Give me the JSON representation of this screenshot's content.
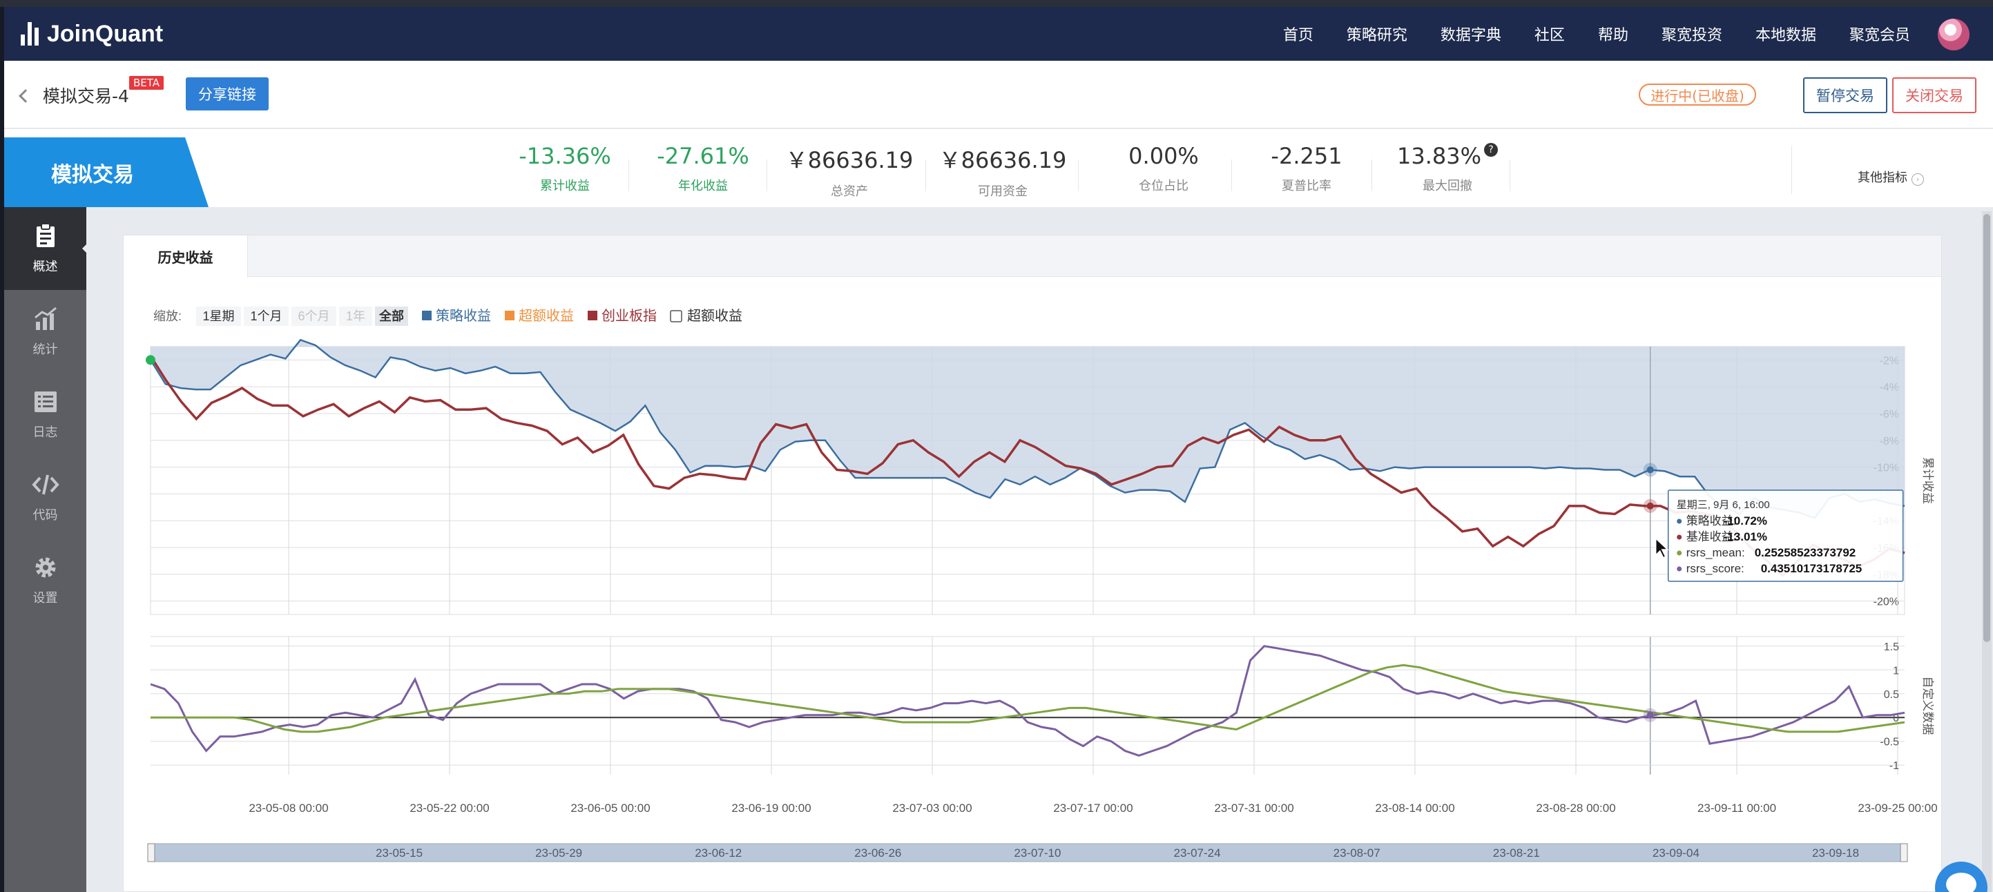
{
  "app": {
    "logo": "JoinQuant"
  },
  "nav": {
    "items": [
      "首页",
      "策略研究",
      "数据字典",
      "社区",
      "帮助",
      "聚宽投资",
      "本地数据",
      "聚宽会员"
    ]
  },
  "header": {
    "title": "模拟交易-4",
    "beta": "BETA",
    "share": "分享链接",
    "status": "进行中(已收盘)",
    "pause": "暂停交易",
    "close": "关闭交易"
  },
  "stats": {
    "mode": "模拟交易",
    "items": [
      {
        "value": "-13.36%",
        "label": "累计收益"
      },
      {
        "value": "-27.61%",
        "label": "年化收益"
      },
      {
        "value": "￥86636.19",
        "label": "总资产"
      },
      {
        "value": "￥86636.19",
        "label": "可用资金"
      },
      {
        "value": "0.00%",
        "label": "仓位占比"
      },
      {
        "value": "-2.251",
        "label": "夏普比率"
      },
      {
        "value": "13.83%",
        "label": "最大回撤"
      }
    ],
    "help": "?",
    "other": "其他指标",
    "colors": {
      "positive_label": "#2da35e"
    }
  },
  "sidebar": {
    "items": [
      {
        "label": "概述",
        "icon": "clipboard-icon"
      },
      {
        "label": "统计",
        "icon": "bar-chart-icon"
      },
      {
        "label": "日志",
        "icon": "list-icon"
      },
      {
        "label": "代码",
        "icon": "code-icon"
      },
      {
        "label": "设置",
        "icon": "gear-icon"
      }
    ]
  },
  "panel": {
    "tab": "历史收益"
  },
  "chart_data": {
    "type": "line",
    "controls": {
      "zoom_label": "缩放:",
      "ranges": [
        "1星期",
        "1个月",
        "6个月",
        "1年",
        "全部"
      ],
      "active_range": "全部",
      "disabled_ranges": [
        "6个月",
        "1年"
      ],
      "checkbox_label": "超额收益"
    },
    "legend": [
      {
        "name": "策略收益",
        "color": "#3c6e9f"
      },
      {
        "name": "超额收益",
        "color": "#f0903c"
      },
      {
        "name": "创业板指",
        "color": "#9b3336"
      }
    ],
    "main": {
      "ylabel": "累计收益",
      "ylim": [
        -21,
        -1
      ],
      "yticks": [
        "-2%",
        "-4%",
        "-6%",
        "-8%",
        "-10%",
        "-12%",
        "-14%",
        "-16%",
        "-18%",
        "-20%"
      ],
      "ytick_values": [
        -2,
        -4,
        -6,
        -8,
        -10,
        -12,
        -14,
        -16,
        -18,
        -20
      ],
      "series": [
        {
          "name": "策略收益",
          "color": "#3c6e9f",
          "values": [
            -2.0,
            -3.8,
            -4.1,
            -4.2,
            -4.2,
            -3.3,
            -2.4,
            -2.0,
            -1.6,
            -1.9,
            -0.5,
            -0.9,
            -1.8,
            -2.4,
            -2.8,
            -3.3,
            -1.8,
            -2.0,
            -2.5,
            -2.8,
            -2.6,
            -3.0,
            -2.8,
            -2.5,
            -3.0,
            -3.0,
            -2.9,
            -4.4,
            -5.7,
            -6.2,
            -6.7,
            -7.3,
            -6.6,
            -5.4,
            -7.4,
            -8.7,
            -10.4,
            -9.9,
            -9.9,
            -10.0,
            -9.9,
            -10.3,
            -8.7,
            -8.1,
            -8.0,
            -8.0,
            -9.5,
            -10.8,
            -10.8,
            -10.8,
            -10.8,
            -10.8,
            -10.8,
            -10.8,
            -11.3,
            -11.9,
            -12.3,
            -10.9,
            -11.3,
            -10.7,
            -11.3,
            -10.8,
            -10.1,
            -10.6,
            -11.4,
            -11.9,
            -11.7,
            -11.7,
            -11.8,
            -12.6,
            -10.1,
            -10.0,
            -7.2,
            -6.7,
            -7.6,
            -8.3,
            -8.7,
            -9.4,
            -9.1,
            -9.5,
            -10.2,
            -10.1,
            -10.3,
            -10.0,
            -10.1,
            -10.0,
            -10.0,
            -10.0,
            -10.0,
            -10.0,
            -10.0,
            -10.0,
            -10.0,
            -10.1,
            -10.0,
            -10.1,
            -10.1,
            -10.2,
            -10.2,
            -10.7,
            -10.2,
            -10.3,
            -10.7,
            -10.7,
            -12.2,
            -13.0,
            -13.5,
            -12.3,
            -13.0,
            -13.2,
            -13.4,
            -13.8,
            -12.3,
            -12.0,
            -12.6,
            -12.4,
            -12.7,
            -12.9
          ]
        },
        {
          "name": "创业板指",
          "color": "#9b3336",
          "values": [
            -1.7,
            -3.5,
            -5.1,
            -6.4,
            -5.2,
            -4.7,
            -4.1,
            -4.9,
            -5.4,
            -5.4,
            -6.2,
            -5.7,
            -5.3,
            -6.2,
            -5.6,
            -5.1,
            -5.9,
            -4.8,
            -5.1,
            -5.0,
            -5.7,
            -5.7,
            -5.6,
            -6.4,
            -6.7,
            -6.9,
            -7.3,
            -8.3,
            -7.8,
            -8.9,
            -8.4,
            -7.6,
            -9.8,
            -11.4,
            -11.6,
            -10.8,
            -10.5,
            -10.6,
            -10.8,
            -10.9,
            -8.2,
            -6.8,
            -7.1,
            -6.8,
            -8.9,
            -10.2,
            -10.3,
            -10.5,
            -9.7,
            -8.3,
            -8.0,
            -8.9,
            -9.6,
            -10.7,
            -9.6,
            -8.9,
            -9.6,
            -8.0,
            -8.5,
            -9.2,
            -9.9,
            -10.1,
            -10.5,
            -11.3,
            -10.9,
            -10.5,
            -10.0,
            -9.9,
            -8.4,
            -7.8,
            -8.2,
            -7.6,
            -7.2,
            -8.1,
            -7.0,
            -7.6,
            -8.0,
            -8.0,
            -7.7,
            -9.4,
            -10.5,
            -11.2,
            -11.9,
            -11.6,
            -12.9,
            -13.8,
            -14.8,
            -14.6,
            -15.9,
            -15.2,
            -15.9,
            -15.0,
            -14.4,
            -12.9,
            -12.9,
            -13.4,
            -13.5,
            -12.8,
            -12.9,
            -12.9,
            -13.4,
            -13.3,
            -13.5,
            -13.9,
            -14.9,
            -16.1,
            -17.0,
            -18.1,
            -17.0,
            -15.8,
            -16.4,
            -16.9,
            -17.4,
            -16.9,
            -16.1,
            -16.4
          ]
        }
      ],
      "tooltip": {
        "title": "星期三, 9月 6, 16:00",
        "rows": [
          {
            "label": "策略收益: ",
            "value": "-10.72%",
            "color": "#3c6e9f"
          },
          {
            "label": "基准收益: ",
            "value": "-13.01%",
            "color": "#9b3336"
          },
          {
            "label": "rsrs_mean: ",
            "value": "0.25258523373792",
            "color": "#7fa340"
          },
          {
            "label": "rsrs_score: ",
            "value": "0.43510173178725",
            "color": "#7b5fa0"
          }
        ]
      }
    },
    "sub": {
      "ylabel": "自定义数据",
      "ylim": [
        -1.2,
        1.7
      ],
      "yticks": [
        "1.5",
        "1",
        "0.5",
        "0",
        "-0.5",
        "-1"
      ],
      "ytick_values": [
        1.5,
        1,
        0.5,
        0,
        -0.5,
        -1
      ],
      "series": [
        {
          "name": "rsrs_score",
          "color": "#7b5fa0",
          "values": [
            0.7,
            0.6,
            0.3,
            -0.3,
            -0.7,
            -0.4,
            -0.4,
            -0.35,
            -0.3,
            -0.2,
            -0.15,
            -0.2,
            -0.15,
            0.05,
            0.1,
            0.05,
            0.0,
            0.15,
            0.3,
            0.8,
            0.05,
            -0.05,
            0.3,
            0.5,
            0.6,
            0.7,
            0.7,
            0.7,
            0.7,
            0.5,
            0.6,
            0.7,
            0.7,
            0.6,
            0.4,
            0.55,
            0.6,
            0.6,
            0.6,
            0.55,
            0.4,
            -0.05,
            -0.1,
            -0.2,
            -0.1,
            -0.05,
            0.0,
            0.05,
            0.05,
            0.05,
            0.1,
            0.1,
            0.05,
            0.1,
            0.2,
            0.15,
            0.2,
            0.3,
            0.3,
            0.35,
            0.3,
            0.35,
            0.2,
            -0.1,
            -0.2,
            -0.25,
            -0.45,
            -0.6,
            -0.4,
            -0.5,
            -0.7,
            -0.8,
            -0.7,
            -0.6,
            -0.45,
            -0.3,
            -0.2,
            -0.1,
            0.1,
            1.2,
            1.5,
            1.45,
            1.4,
            1.35,
            1.3,
            1.2,
            1.1,
            1.0,
            0.95,
            0.85,
            0.6,
            0.5,
            0.55,
            0.5,
            0.4,
            0.5,
            0.4,
            0.3,
            0.35,
            0.3,
            0.35,
            0.35,
            0.3,
            0.2,
            0.0,
            -0.05,
            -0.1,
            0.0,
            0.05,
            0.1,
            0.2,
            0.35,
            -0.55,
            -0.5,
            -0.45,
            -0.4,
            -0.3,
            -0.2,
            -0.1,
            0.05,
            0.2,
            0.35,
            0.65,
            0.0,
            0.05,
            0.05,
            0.1
          ]
        },
        {
          "name": "rsrs_mean",
          "color": "#7fa340",
          "values": [
            0.0,
            0.0,
            0.0,
            0.0,
            0.0,
            0.0,
            -0.05,
            -0.15,
            -0.25,
            -0.3,
            -0.3,
            -0.25,
            -0.2,
            -0.1,
            0.0,
            0.05,
            0.1,
            0.15,
            0.2,
            0.25,
            0.3,
            0.35,
            0.4,
            0.45,
            0.5,
            0.5,
            0.55,
            0.55,
            0.6,
            0.6,
            0.6,
            0.6,
            0.55,
            0.5,
            0.45,
            0.4,
            0.35,
            0.3,
            0.25,
            0.2,
            0.15,
            0.1,
            0.05,
            0.0,
            -0.05,
            -0.1,
            -0.1,
            -0.1,
            -0.1,
            -0.1,
            -0.05,
            0.0,
            0.05,
            0.1,
            0.15,
            0.2,
            0.2,
            0.15,
            0.1,
            0.05,
            0.0,
            -0.05,
            -0.1,
            -0.15,
            -0.2,
            -0.25,
            -0.1,
            0.05,
            0.2,
            0.35,
            0.5,
            0.65,
            0.8,
            0.95,
            1.05,
            1.1,
            1.05,
            0.95,
            0.85,
            0.75,
            0.65,
            0.55,
            0.5,
            0.45,
            0.4,
            0.35,
            0.3,
            0.25,
            0.2,
            0.15,
            0.1,
            0.05,
            0.0,
            -0.05,
            -0.1,
            -0.15,
            -0.2,
            -0.25,
            -0.3,
            -0.3,
            -0.3,
            -0.3,
            -0.25,
            -0.2,
            -0.15,
            -0.1
          ]
        }
      ]
    },
    "xticks": [
      "23-05-08 00:00",
      "23-05-22 00:00",
      "23-06-05 00:00",
      "23-06-19 00:00",
      "23-07-03 00:00",
      "23-07-17 00:00",
      "23-07-31 00:00",
      "23-08-14 00:00",
      "23-08-28 00:00",
      "23-09-11 00:00",
      "23-09-25 00:00"
    ],
    "navigator_labels": [
      "23-05-15",
      "23-05-29",
      "23-06-12",
      "23-06-26",
      "23-07-10",
      "23-07-24",
      "23-08-07",
      "23-08-21",
      "23-09-04",
      "23-09-18"
    ],
    "hover_index_fraction": 0.855
  }
}
